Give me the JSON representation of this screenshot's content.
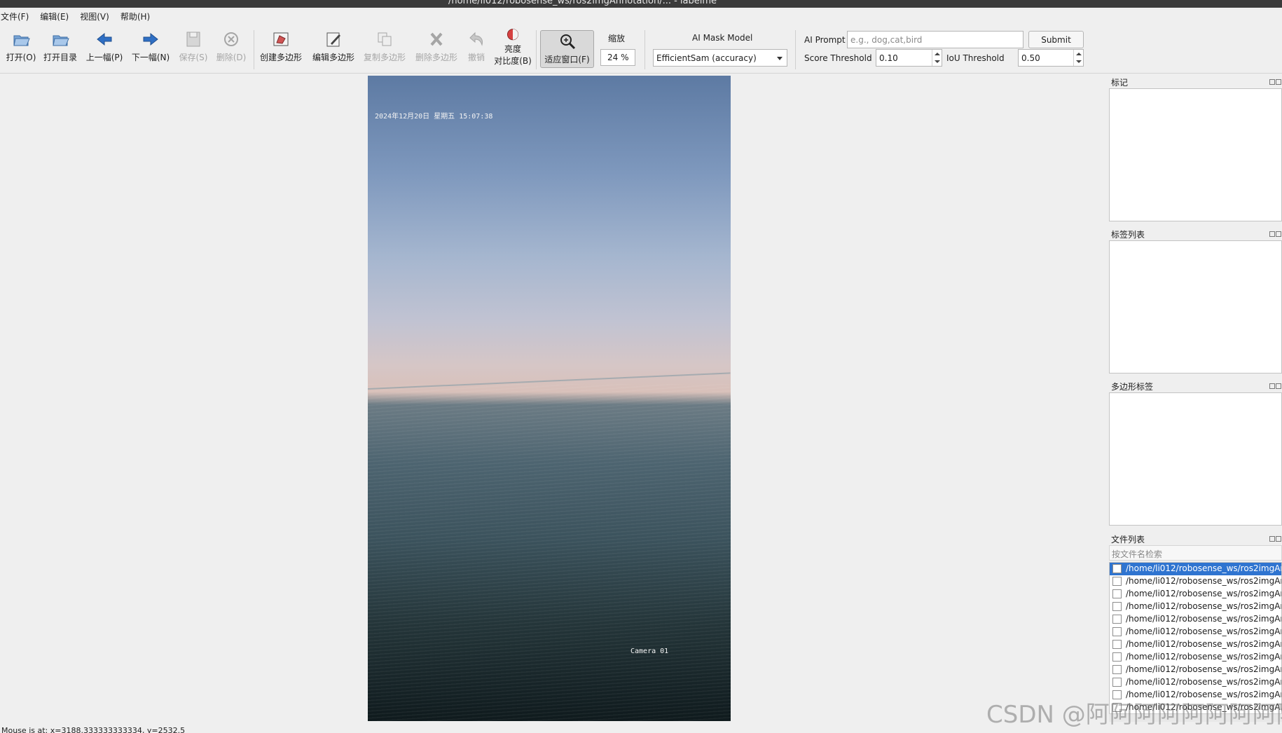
{
  "window": {
    "title": "/home/li012/robosense_ws/ros2imgAnnotation/... - labelme"
  },
  "menu": [
    "文件(F)",
    "编辑(E)",
    "视图(V)",
    "帮助(H)"
  ],
  "toolbar": {
    "open": "打开(O)",
    "open_dir": "打开目录",
    "prev": "上一幅(P)",
    "next": "下一幅(N)",
    "save": "保存(S)",
    "delete": "删除(D)",
    "create_polygon": "创建多边形",
    "edit_polygon": "编辑多边形",
    "copy_polygon": "复制多边形",
    "delete_polygon": "删除多边形",
    "undo": "撤销",
    "brightness_1": "亮度",
    "brightness_2": "对比度(B)",
    "fit_window": "适应窗口(F)",
    "zoom_label": "缩放",
    "zoom_value": "24 %",
    "ai_mask_model_label": "AI Mask Model",
    "ai_mask_model_value": "EfficientSam (accuracy)",
    "ai_prompt_label": "AI Prompt",
    "ai_prompt_placeholder": "e.g., dog,cat,bird",
    "submit": "Submit",
    "score_threshold_label": "Score Threshold",
    "score_threshold_value": "0.10",
    "iou_threshold_label": "IoU Threshold",
    "iou_threshold_value": "0.50"
  },
  "image": {
    "timestamp": "2024年12月20日 星期五 15:07:38",
    "camera": "Camera 01"
  },
  "docks": {
    "flags_title": "标记",
    "label_list_title": "标签列表",
    "polygon_labels_title": "多边形标签",
    "file_list_title": "文件列表",
    "file_search_placeholder": "按文件名检索",
    "files": [
      "/home/li012/robosense_ws/ros2imgAn",
      "/home/li012/robosense_ws/ros2imgAn",
      "/home/li012/robosense_ws/ros2imgAn",
      "/home/li012/robosense_ws/ros2imgAn",
      "/home/li012/robosense_ws/ros2imgAn",
      "/home/li012/robosense_ws/ros2imgAn",
      "/home/li012/robosense_ws/ros2imgAn",
      "/home/li012/robosense_ws/ros2imgAn",
      "/home/li012/robosense_ws/ros2imgAn",
      "/home/li012/robosense_ws/ros2imgAn",
      "/home/li012/robosense_ws/ros2imgAn",
      "/home/li012/robosense_ws/ros2imgAn"
    ]
  },
  "status": {
    "mouse": "Mouse is at: x=3188.333333333334, y=2532.5"
  },
  "watermark": "CSDN @阿阿阿阿阿阿阿阿阿",
  "colors": {
    "selection": "#2f74d0",
    "accent_blue_arrow": "#2f6fc4"
  },
  "icons": [
    "open-icon",
    "open-dir-icon",
    "prev-arrow-icon",
    "next-arrow-icon",
    "save-icon",
    "delete-icon",
    "create-polygon-icon",
    "edit-polygon-icon",
    "copy-polygon-icon",
    "delete-polygon-icon",
    "undo-icon",
    "brightness-icon",
    "fit-window-icon"
  ]
}
